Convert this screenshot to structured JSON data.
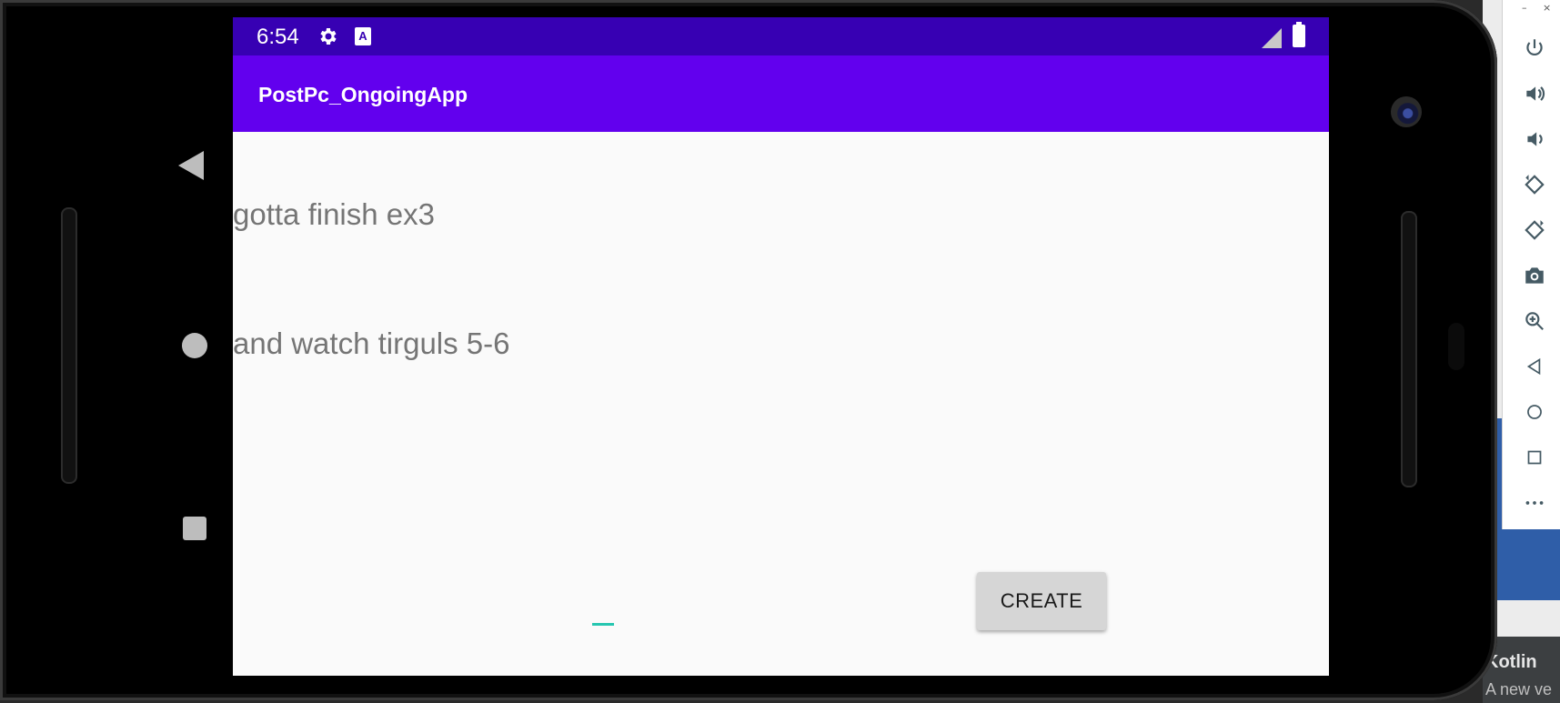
{
  "status_bar": {
    "time": "6:54",
    "a_icon_letter": "A"
  },
  "app_bar": {
    "title": "PostPc_OngoingApp"
  },
  "todos": [
    {
      "text": "gotta finish ex3"
    },
    {
      "text": "and watch tirguls 5-6"
    }
  ],
  "create_button": {
    "label": "CREATE"
  },
  "emulator_toolbar": {
    "minimize": "–",
    "close": "×",
    "items": [
      "power-icon",
      "volume-up-icon",
      "volume-down-icon",
      "rotate-left-icon",
      "rotate-right-icon",
      "camera-icon",
      "zoom-icon",
      "back-icon",
      "home-icon",
      "overview-icon",
      "more-icon"
    ]
  },
  "ide": {
    "kotlin": "Kotlin",
    "anew": "A new ve"
  },
  "colors": {
    "status_bar": "#3700b3",
    "app_bar": "#6200ee",
    "accent": "#26c6b0"
  }
}
